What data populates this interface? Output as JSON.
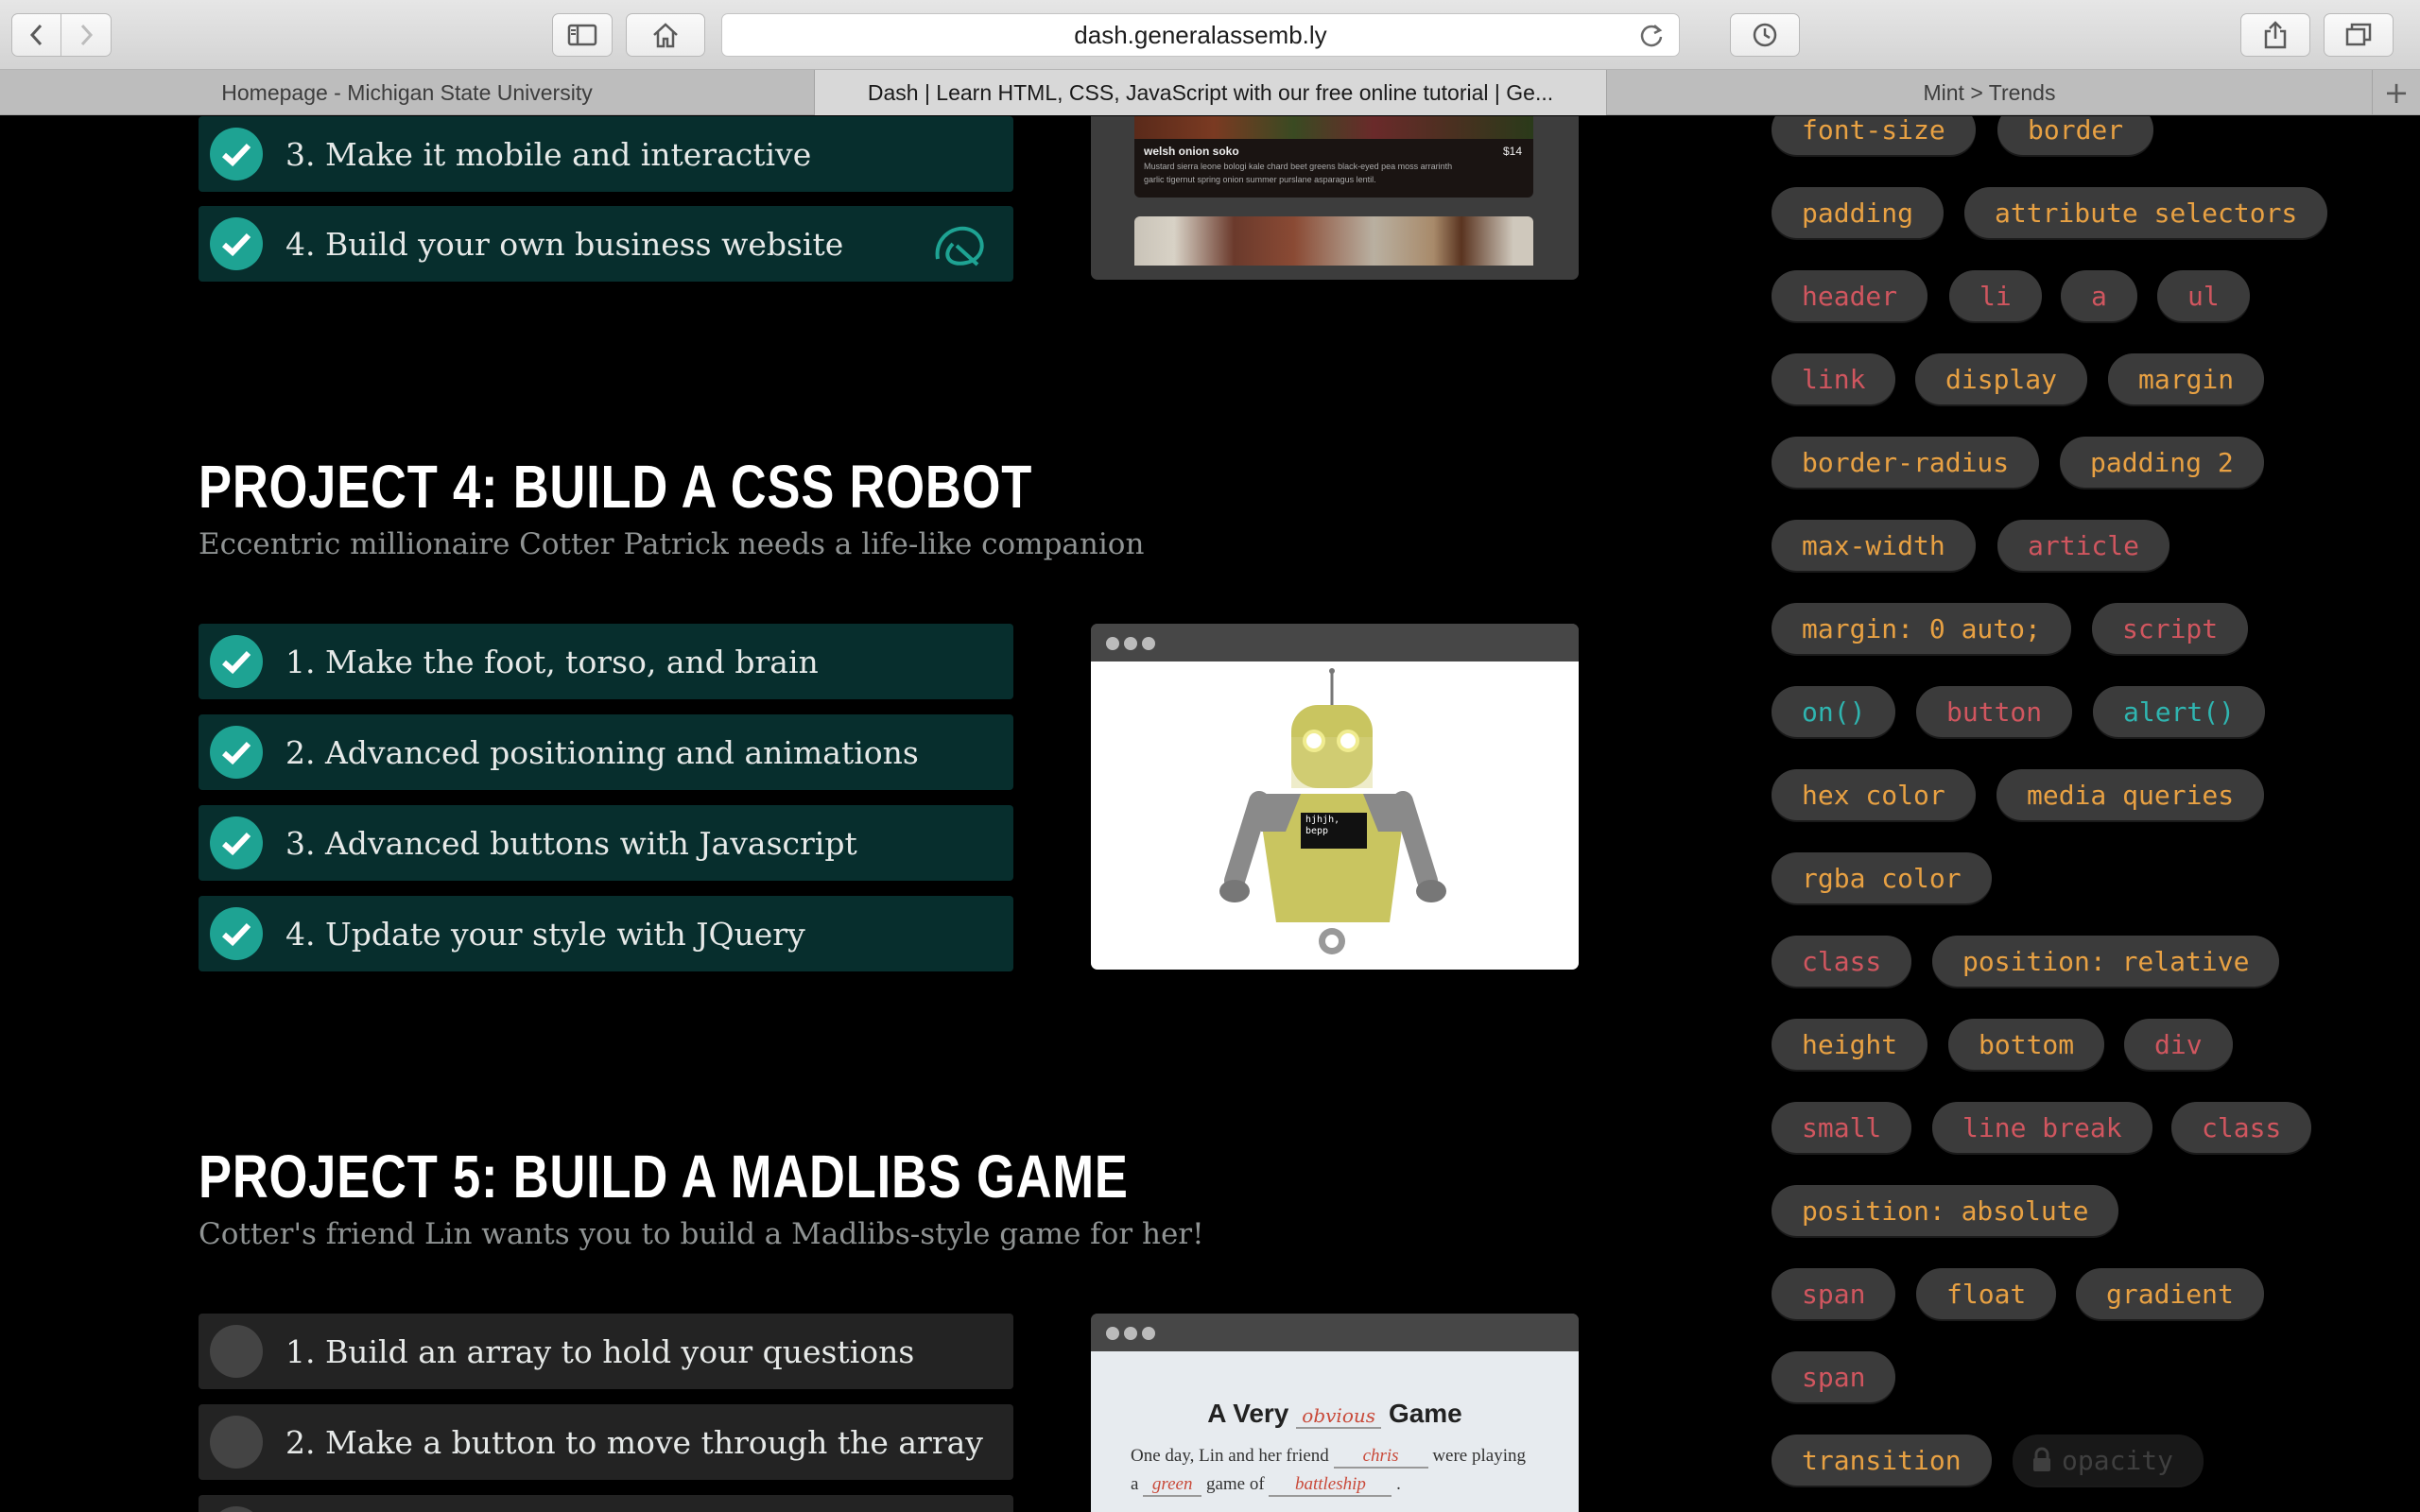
{
  "browser": {
    "url": "dash.generalassemb.ly",
    "tabs": [
      "Homepage - Michigan State University",
      "Dash | Learn HTML, CSS, JavaScript with our free online tutorial | Ge...",
      "Mint > Trends"
    ],
    "active_tab": 1
  },
  "project3": {
    "tasks": [
      {
        "label": "3. Make it mobile and interactive",
        "done": true
      },
      {
        "label": "4. Build your own business website",
        "done": true
      }
    ],
    "preview": {
      "dish": "welsh onion soko",
      "price": "$14",
      "desc1": "Mustard sierra leone bologi kale chard beet greens black-eyed pea moss arrarinth",
      "desc2": "garlic tigernut spring onion summer purslane asparagus lentil."
    }
  },
  "project4": {
    "title": "PROJECT 4: BUILD A CSS ROBOT",
    "subtitle": "Eccentric millionaire Cotter Patrick needs a life-like companion",
    "tasks": [
      {
        "label": "1. Make the foot, torso, and brain",
        "done": true
      },
      {
        "label": "2. Advanced positioning and animations",
        "done": true
      },
      {
        "label": "3. Advanced buttons with Javascript",
        "done": true
      },
      {
        "label": "4. Update your style with JQuery",
        "done": true
      }
    ],
    "preview": {
      "robot_screen_line1": "hjhjh,",
      "robot_screen_line2": "bepp"
    }
  },
  "project5": {
    "title": "PROJECT 5: BUILD A MADLIBS GAME",
    "subtitle": "Cotter's friend Lin wants you to build a Madlibs-style game for her!",
    "tasks": [
      {
        "label": "1. Build an array to hold your questions",
        "done": false
      },
      {
        "label": "2. Make a button to move through the array",
        "done": false
      }
    ],
    "preview": {
      "title_before": "A Very",
      "title_word": "obvious",
      "title_after": "Game",
      "line1_before": "One day, Lin and her friend",
      "line1_word": "chris",
      "line1_after": "were playing",
      "line2_before": "a",
      "line2_word": "green",
      "line2_mid": "game of",
      "line2_word2": "battleship",
      "line2_after": "."
    }
  },
  "tags": [
    {
      "label": "font-size",
      "color": "orange"
    },
    {
      "label": "border",
      "color": "orange"
    },
    {
      "label": "padding",
      "color": "orange"
    },
    {
      "label": "attribute selectors",
      "color": "orange"
    },
    {
      "label": "header",
      "color": "red"
    },
    {
      "label": "li",
      "color": "red"
    },
    {
      "label": "a",
      "color": "red"
    },
    {
      "label": "ul",
      "color": "red"
    },
    {
      "label": "link",
      "color": "red"
    },
    {
      "label": "display",
      "color": "orange"
    },
    {
      "label": "margin",
      "color": "orange"
    },
    {
      "label": "border-radius",
      "color": "orange"
    },
    {
      "label": "padding 2",
      "color": "orange"
    },
    {
      "label": "max-width",
      "color": "orange"
    },
    {
      "label": "article",
      "color": "red"
    },
    {
      "label": "margin: 0 auto;",
      "color": "orange"
    },
    {
      "label": "script",
      "color": "red"
    },
    {
      "label": "on()",
      "color": "teal"
    },
    {
      "label": "button",
      "color": "red"
    },
    {
      "label": "alert()",
      "color": "teal"
    },
    {
      "label": "hex color",
      "color": "orange"
    },
    {
      "label": "media queries",
      "color": "orange"
    },
    {
      "label": "rgba color",
      "color": "orange"
    },
    {
      "label": "class",
      "color": "red"
    },
    {
      "label": "position: relative",
      "color": "orange"
    },
    {
      "label": "height",
      "color": "orange"
    },
    {
      "label": "bottom",
      "color": "orange"
    },
    {
      "label": "div",
      "color": "red"
    },
    {
      "label": "small",
      "color": "red"
    },
    {
      "label": "line break",
      "color": "red"
    },
    {
      "label": "class",
      "color": "red"
    },
    {
      "label": "position: absolute",
      "color": "orange"
    },
    {
      "label": "span",
      "color": "red"
    },
    {
      "label": "float",
      "color": "orange"
    },
    {
      "label": "gradient",
      "color": "orange"
    },
    {
      "label": "span",
      "color": "red"
    },
    {
      "label": "transition",
      "color": "orange"
    },
    {
      "label": "opacity",
      "color": "locked"
    }
  ],
  "colors": {
    "tag_orange": "#e8a143",
    "tag_red": "#d0565f",
    "tag_teal": "#2fb5b0",
    "task_done_bg": "#072e2d",
    "check_done": "#1ea393"
  }
}
